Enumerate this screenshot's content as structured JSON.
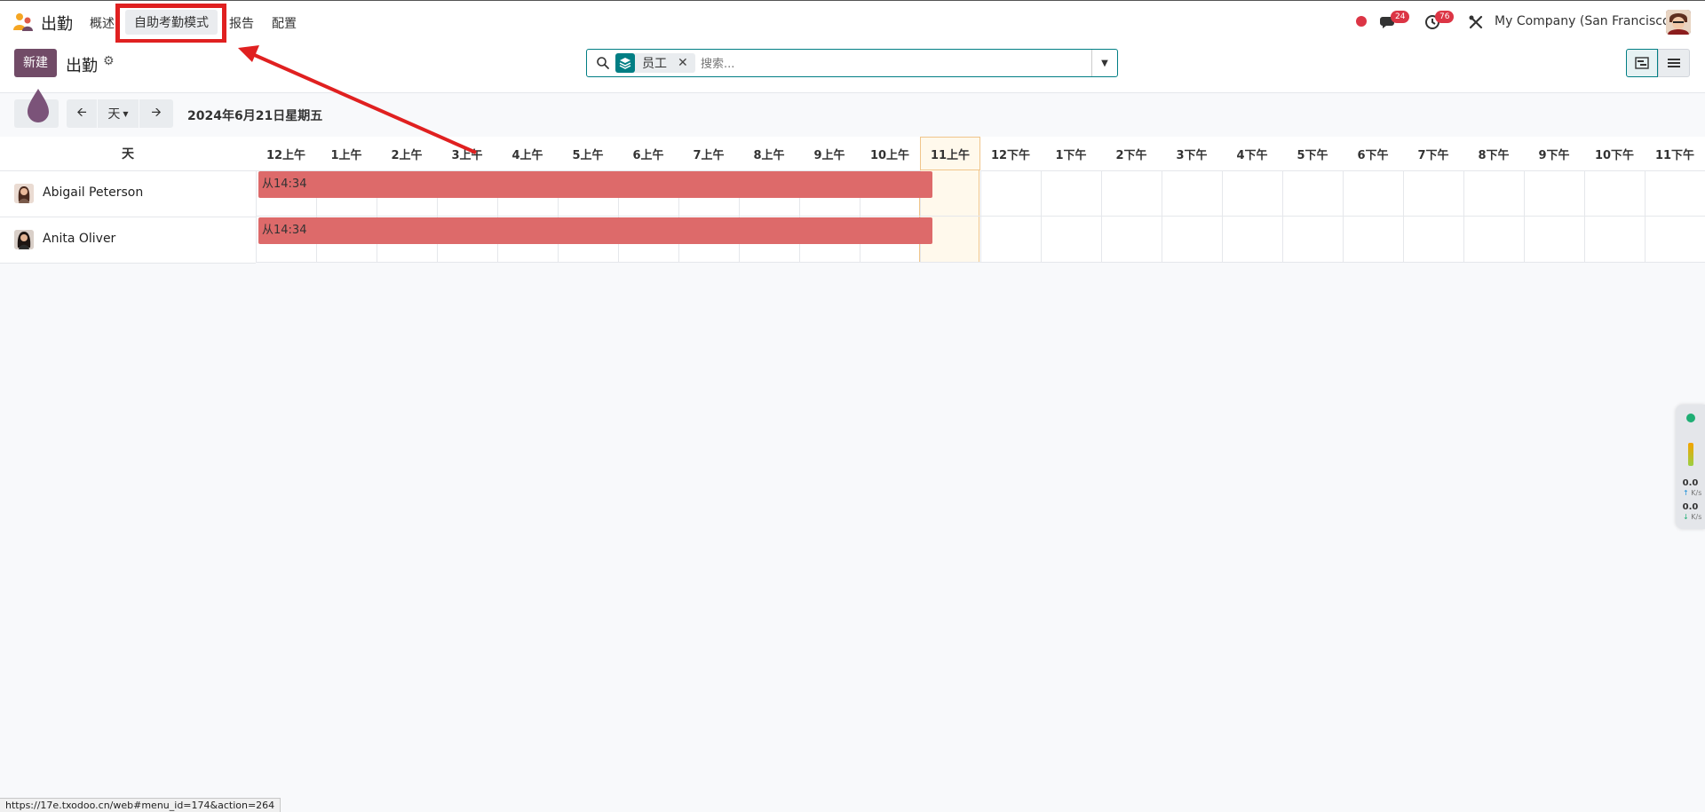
{
  "app": {
    "name": "出勤",
    "menu": [
      {
        "label": "概述"
      },
      {
        "label": "自助考勤模式"
      },
      {
        "label": "报告"
      },
      {
        "label": "配置"
      }
    ],
    "messages_badge": "24",
    "activities_badge": "76",
    "company": "My Company (San Francisco)"
  },
  "control_panel": {
    "new_label": "新建",
    "title": "出勤",
    "search": {
      "facet_label": "员工",
      "placeholder": "搜索..."
    }
  },
  "gantt_toolbar": {
    "scale_label": "天",
    "date_label": "2024年6月21日星期五"
  },
  "gantt": {
    "group_header": "天",
    "hours": [
      "12上午",
      "1上午",
      "2上午",
      "3上午",
      "4上午",
      "5上午",
      "6上午",
      "7上午",
      "8上午",
      "9上午",
      "10上午",
      "11上午",
      "12下午",
      "1下午",
      "2下午",
      "3下午",
      "4下午",
      "5下午",
      "6下午",
      "7下午",
      "8下午",
      "9下午",
      "10下午",
      "11下午"
    ],
    "today_hour": "11上午",
    "rows": [
      {
        "name": "Abigail Peterson",
        "pill_label": "从14:34"
      },
      {
        "name": "Anita Oliver",
        "pill_label": "从14:34"
      }
    ]
  },
  "side_widget": {
    "up_value": "0.0",
    "up_unit": "K/s",
    "down_value": "0.0",
    "down_unit": "K/s"
  },
  "status_url": "https://17e.txodoo.cn/web#menu_id=174&action=264",
  "colors": {
    "brand": "#714b67",
    "accent": "#017e84",
    "pill": "#dd6a6a",
    "highlight": "#e02020"
  }
}
